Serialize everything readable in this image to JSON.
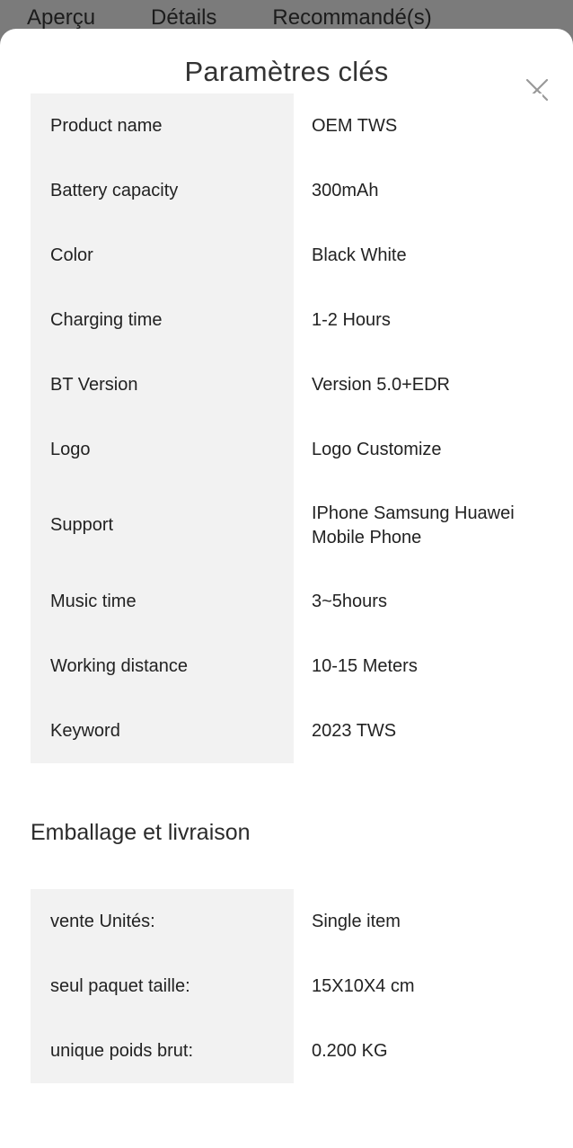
{
  "background": {
    "tabs": [
      {
        "label": "Aperçu"
      },
      {
        "label": "Détails"
      },
      {
        "label": "Recommandé(s)"
      }
    ]
  },
  "modal": {
    "title": "Paramètres clés",
    "close_icon": "close-icon",
    "key_specs": {
      "rows": [
        {
          "key": "Product name",
          "value": "OEM TWS"
        },
        {
          "key": "Battery capacity",
          "value": "300mAh"
        },
        {
          "key": "Color",
          "value": "Black White"
        },
        {
          "key": "Charging time",
          "value": "1-2 Hours"
        },
        {
          "key": "BT Version",
          "value": "Version 5.0+EDR"
        },
        {
          "key": "Logo",
          "value": "Logo Customize"
        },
        {
          "key": "Support",
          "value": "IPhone Samsung Huawei Mobile Phone"
        },
        {
          "key": "Music time",
          "value": "3~5hours"
        },
        {
          "key": "Working distance",
          "value": "10-15 Meters"
        },
        {
          "key": "Keyword",
          "value": "2023 TWS"
        }
      ]
    },
    "packaging": {
      "heading": "Emballage et livraison",
      "rows": [
        {
          "key": "vente Unités:",
          "value": "Single item"
        },
        {
          "key": "seul paquet taille:",
          "value": "15X10X4 cm"
        },
        {
          "key": "unique poids brut:",
          "value": "0.200 KG"
        }
      ]
    }
  },
  "colors": {
    "overlay": "#7b7b7b",
    "sheet": "#ffffff",
    "label_cell": "#f2f2f2",
    "text": "#222222",
    "close": "#999999"
  }
}
